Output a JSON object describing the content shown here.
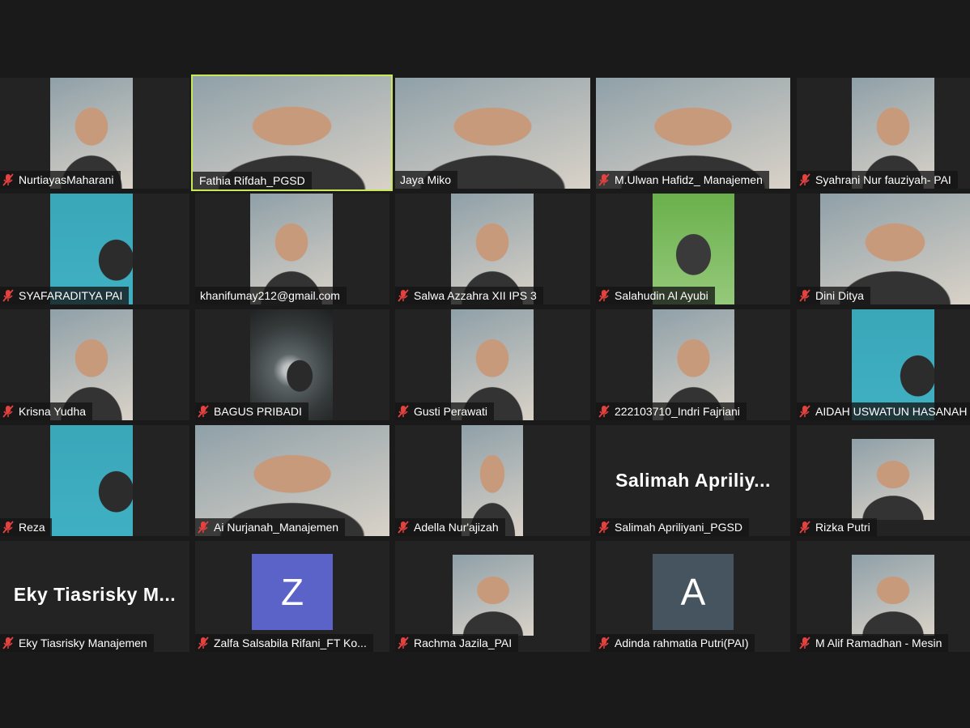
{
  "gallery": {
    "participants": [
      {
        "name": "NurtiayasMaharani",
        "muted": true
      },
      {
        "name": "Fathia Rifdah_PGSD",
        "muted": false,
        "active_speaker": true
      },
      {
        "name": "Jaya Miko",
        "muted": false
      },
      {
        "name": "M.Ulwan Hafidz_ Manajemen",
        "muted": true
      },
      {
        "name": "Syahrani Nur fauziyah- PAI",
        "muted": true
      },
      {
        "name": "SYAFARADITYA PAI",
        "muted": true
      },
      {
        "name": "khanifumay212@gmail.com",
        "muted": false
      },
      {
        "name": "Salwa Azzahra XII IPS 3",
        "muted": true
      },
      {
        "name": "Salahudin Al Ayubi",
        "muted": true
      },
      {
        "name": "Dini Ditya",
        "muted": true
      },
      {
        "name": "Krisna Yudha",
        "muted": true
      },
      {
        "name": "BAGUS PRIBADI",
        "muted": true
      },
      {
        "name": "Gusti Perawati",
        "muted": true
      },
      {
        "name": "222103710_Indri Fajriani",
        "muted": true
      },
      {
        "name": "AIDAH USWATUN HASANAH",
        "muted": true
      },
      {
        "name": "Reza",
        "muted": true
      },
      {
        "name": "Ai Nurjanah_Manajemen",
        "muted": true
      },
      {
        "name": "Adella Nur'ajizah",
        "muted": true
      },
      {
        "name": "Salimah Apriliyani_PGSD",
        "muted": true,
        "display_text": "Salimah  Apriliy..."
      },
      {
        "name": "Rizka Putri",
        "muted": true
      },
      {
        "name": "Eky Tiasrisky Manajemen",
        "muted": true,
        "display_text": "Eky  Tiasrisky  M..."
      },
      {
        "name": "Zalfa Salsabila Rifani_FT Ko...",
        "muted": true,
        "avatar_letter": "Z",
        "avatar_color": "#5b63c9"
      },
      {
        "name": "Rachma Jazila_PAI",
        "muted": true
      },
      {
        "name": "Adinda rahmatia Putri(PAI)",
        "muted": true,
        "avatar_letter": "A",
        "avatar_color": "#46545f"
      },
      {
        "name": "M Alif Ramadhan - Mesin",
        "muted": true
      }
    ]
  },
  "icons": {
    "muted": "mic-muted-icon"
  },
  "colors": {
    "active_border": "#c8e85a",
    "mute_red": "#e5413f",
    "background": "#1a1a1a"
  }
}
